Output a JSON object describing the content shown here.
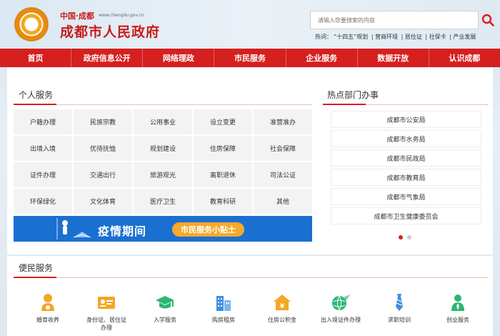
{
  "header": {
    "logo_small": "中国·成都",
    "logo_url": "www.chengdu.gov.cn",
    "logo_title": "成都市人民政府",
    "search_placeholder": "请输入您要搜索的内容",
    "hot_label": "热词：",
    "hot_links": [
      "“十四五”规划",
      "营商环境",
      "居住证",
      "社保卡",
      "产业发展"
    ]
  },
  "nav": [
    "首页",
    "政府信息公开",
    "网络理政",
    "市民服务",
    "企业服务",
    "数据开放",
    "认识成都"
  ],
  "personal": {
    "title": "个人服务",
    "items": [
      "户籍办理",
      "民族宗教",
      "公用事业",
      "设立变更",
      "准营准办",
      "出境入境",
      "优待抚恤",
      "规划建设",
      "住房保障",
      "社会保障",
      "证件办理",
      "交通出行",
      "旅游观光",
      "离职退休",
      "司法公证",
      "环保绿化",
      "文化体育",
      "医疗卫生",
      "教育科研",
      "其他"
    ]
  },
  "banner": {
    "text": "疫情期间",
    "pill": "市民服务小贴士"
  },
  "hot_dept": {
    "title": "热点部门办事",
    "items": [
      "成都市公安局",
      "成都市水务局",
      "成都市民政局",
      "成都市教育局",
      "成都市气象局",
      "成都市卫生健康委员会"
    ]
  },
  "convenience": {
    "title": "便民服务",
    "items": [
      {
        "label": "婚育收养",
        "icon": "baby-icon",
        "color": "#f5a623"
      },
      {
        "label": "身份证、居住证办理",
        "icon": "id-card-icon",
        "color": "#f5a623"
      },
      {
        "label": "入学服务",
        "icon": "graduation-cap-icon",
        "color": "#2bb673"
      },
      {
        "label": "购房租房",
        "icon": "building-icon",
        "color": "#3d8fe0"
      },
      {
        "label": "住房公积金",
        "icon": "house-icon",
        "color": "#f5a623"
      },
      {
        "label": "出入境证件办理",
        "icon": "globe-plane-icon",
        "color": "#2bb673"
      },
      {
        "label": "求职培训",
        "icon": "tie-icon",
        "color": "#3d8fe0"
      },
      {
        "label": "创业服务",
        "icon": "person-icon",
        "color": "#2bb673"
      }
    ]
  },
  "colors": {
    "brand_red": "#d61f1f",
    "banner_blue": "#1b6fd1",
    "pill_orange": "#f6a92a"
  }
}
